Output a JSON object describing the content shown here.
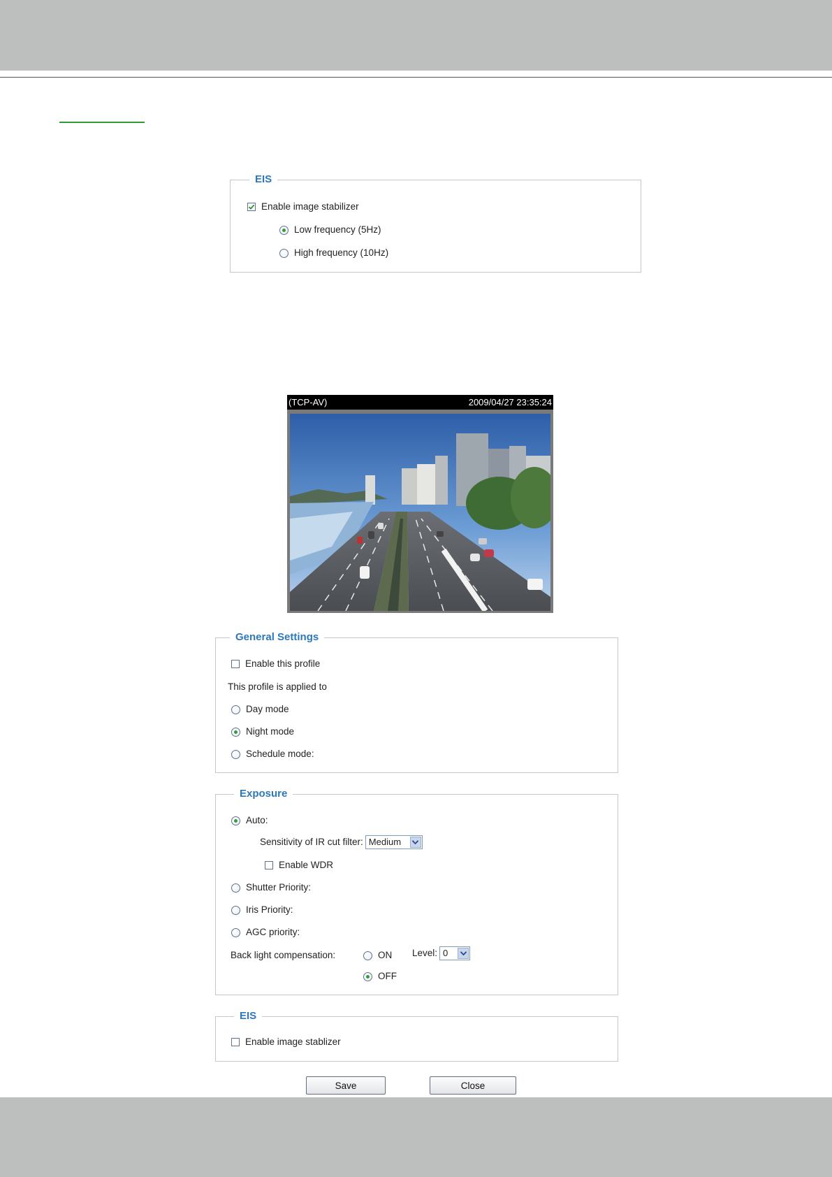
{
  "eis_top": {
    "legend": "EIS",
    "enable_label": "Enable image stabilizer",
    "enable_checked": true,
    "low_label": "Low frequency (5Hz)",
    "high_label": "High frequency (10Hz)",
    "selected": "low"
  },
  "video": {
    "protocol": "(TCP-AV)",
    "timestamp": "2009/04/27 23:35:24"
  },
  "general": {
    "legend": "General Settings",
    "enable_profile_label": "Enable this profile",
    "enable_profile_checked": false,
    "applied_to_label": "This profile is applied to",
    "day_label": "Day mode",
    "night_label": "Night mode",
    "schedule_label": "Schedule mode:",
    "selected": "night"
  },
  "exposure": {
    "legend": "Exposure",
    "auto_label": "Auto:",
    "ir_label": "Sensitivity of IR cut filter:",
    "ir_value": "Medium",
    "wdr_label": "Enable WDR",
    "wdr_checked": false,
    "shutter_label": "Shutter Priority:",
    "iris_label": "Iris Priority:",
    "agc_label": "AGC priority:",
    "selected": "auto",
    "blc_label": "Back light compensation:",
    "blc_on_label": "ON",
    "blc_off_label": "OFF",
    "blc_selected": "off",
    "level_label": "Level:",
    "level_value": "0"
  },
  "eis_bottom": {
    "legend": "EIS",
    "enable_label": "Enable image stablizer",
    "enable_checked": false
  },
  "buttons": {
    "save": "Save",
    "close": "Close"
  },
  "colors": {
    "band": "#bdbfbe",
    "legend": "#2e78b7",
    "accent_green": "#2e9a3a"
  }
}
